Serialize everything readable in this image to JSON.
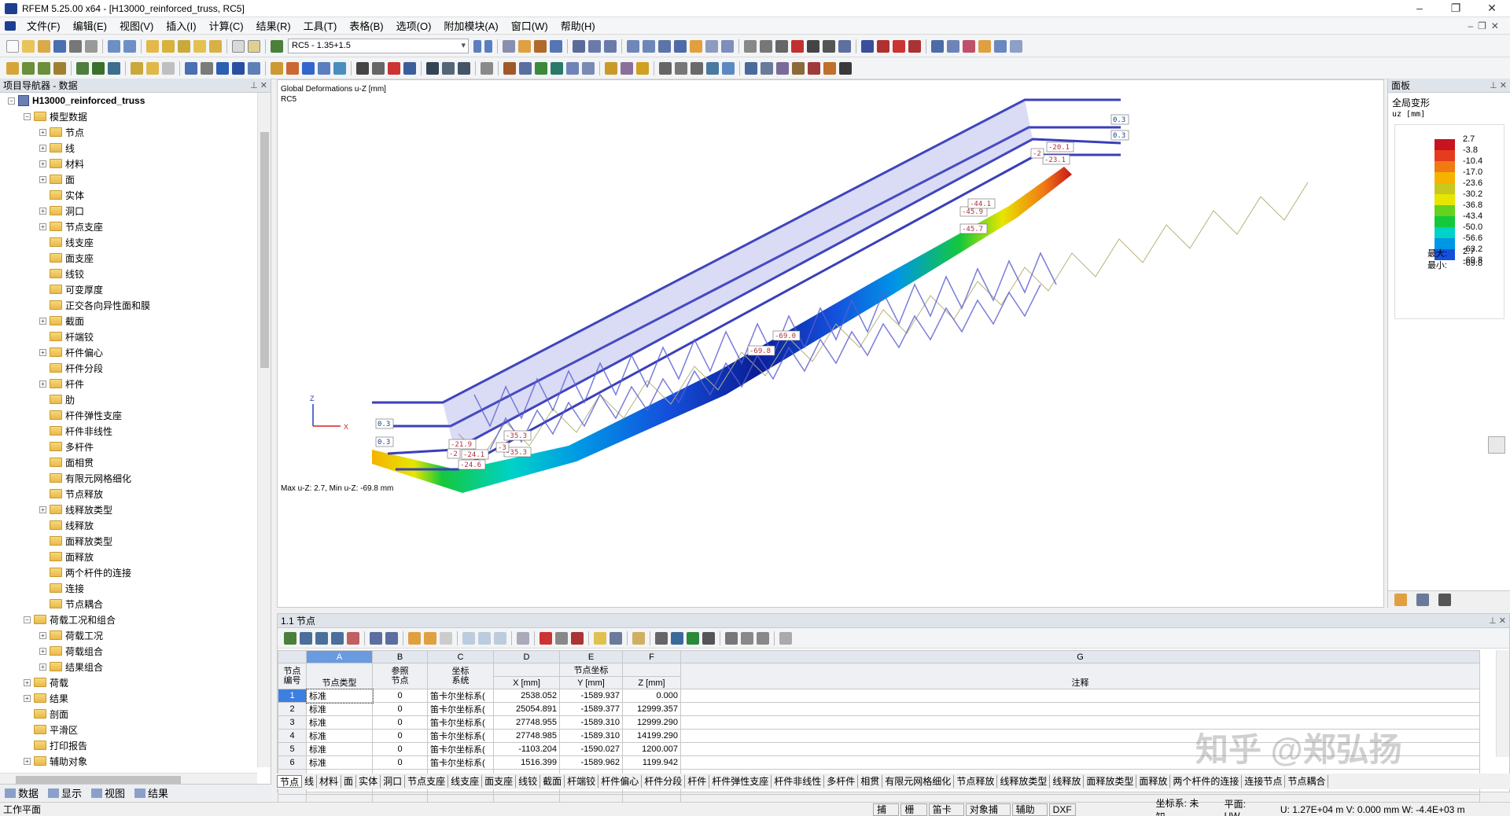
{
  "window": {
    "title": "RFEM 5.25.00 x64 - [H13000_reinforced_truss, RC5]"
  },
  "menu": [
    "文件(F)",
    "编辑(E)",
    "视图(V)",
    "插入(I)",
    "计算(C)",
    "结果(R)",
    "工具(T)",
    "表格(B)",
    "选项(O)",
    "附加模块(A)",
    "窗口(W)",
    "帮助(H)"
  ],
  "toolbar": {
    "loadcase": "RC5 - 1.35+1.5"
  },
  "navigator": {
    "title": "项目导航器 - 数据",
    "project": "H13000_reinforced_truss",
    "items": [
      "模型数据",
      "节点",
      "线",
      "材料",
      "面",
      "实体",
      "洞口",
      "节点支座",
      "线支座",
      "面支座",
      "线铰",
      "可变厚度",
      "正交各向异性面和膜",
      "截面",
      "杆端铰",
      "杆件偏心",
      "杆件分段",
      "杆件",
      "肋",
      "杆件弹性支座",
      "杆件非线性",
      "多杆件",
      "面相贯",
      "有限元网格细化",
      "节点释放",
      "线释放类型",
      "线释放",
      "面释放类型",
      "面释放",
      "两个杆件的连接",
      "连接",
      "节点耦合",
      "荷载工况和组合",
      "荷载工况",
      "荷载组合",
      "结果组合",
      "荷载",
      "结果",
      "剖面",
      "平滑区",
      "打印报告",
      "辅助对象"
    ],
    "tabs": [
      "数据",
      "显示",
      "视图",
      "结果"
    ]
  },
  "viewport": {
    "header1": "Global Deformations u-Z [mm]",
    "header2": "RC5",
    "footer": "Max u-Z: 2.7, Min u-Z: -69.8 mm",
    "axis_x": "X",
    "axis_z": "Z",
    "labels": [
      "0.3",
      "0.3",
      "-20.1",
      "-23.1",
      "-2",
      "-24.1",
      "-24.6",
      "-21.9",
      "-35.3",
      "-35.3",
      "-45.9",
      "-45.7",
      "-44.1",
      "-69.0",
      "-69.8",
      "0.3",
      "0.3",
      "-3",
      "-2"
    ]
  },
  "panel": {
    "title": "面板",
    "result": "全局变形",
    "unit": "uz [mm]",
    "legend_values": [
      "2.7",
      "-3.8",
      "-10.4",
      "-17.0",
      "-23.6",
      "-30.2",
      "-36.8",
      "-43.4",
      "-50.0",
      "-56.6",
      "-63.2",
      "-69.8"
    ],
    "legend_colors": [
      "#c8141e",
      "#e63c1e",
      "#f07a14",
      "#f5b200",
      "#c8c81e",
      "#e6e600",
      "#64d21e",
      "#14c83c",
      "#00d2c8",
      "#0096e6",
      "#1450dc",
      "#0a1e96"
    ],
    "max_label": "最大:",
    "max_val": "2.7",
    "min_label": "最小:",
    "min_val": "-69.8"
  },
  "table": {
    "title": "1.1 节点",
    "col_letters": [
      "A",
      "B",
      "C",
      "D",
      "E",
      "F",
      "G"
    ],
    "h_node": "节点\n编号",
    "h_type": "节点类型",
    "h_ref": "参照\n节点",
    "h_coord": "坐标\n系统",
    "h_coords_group": "节点坐标",
    "h_x": "X [mm]",
    "h_y": "Y [mm]",
    "h_z": "Z [mm]",
    "h_note": "注释",
    "rows": [
      {
        "no": "1",
        "type": "标准",
        "ref": "0",
        "cs": "笛卡尔坐标系(",
        "x": "2538.052",
        "y": "-1589.937",
        "z": "0.000"
      },
      {
        "no": "2",
        "type": "标准",
        "ref": "0",
        "cs": "笛卡尔坐标系(",
        "x": "25054.891",
        "y": "-1589.377",
        "z": "12999.357"
      },
      {
        "no": "3",
        "type": "标准",
        "ref": "0",
        "cs": "笛卡尔坐标系(",
        "x": "27748.955",
        "y": "-1589.310",
        "z": "12999.290"
      },
      {
        "no": "4",
        "type": "标准",
        "ref": "0",
        "cs": "笛卡尔坐标系(",
        "x": "27748.985",
        "y": "-1589.310",
        "z": "14199.290"
      },
      {
        "no": "5",
        "type": "标准",
        "ref": "0",
        "cs": "笛卡尔坐标系(",
        "x": "-1103.204",
        "y": "-1590.027",
        "z": "1200.007"
      },
      {
        "no": "6",
        "type": "标准",
        "ref": "0",
        "cs": "笛卡尔坐标系(",
        "x": "1516.399",
        "y": "-1589.962",
        "z": "1199.942"
      }
    ],
    "sheet_tabs": [
      "节点",
      "线",
      "材料",
      "面",
      "实体",
      "洞口",
      "节点支座",
      "线支座",
      "面支座",
      "线铰",
      "截面",
      "杆端铰",
      "杆件偏心",
      "杆件分段",
      "杆件",
      "杆件弹性支座",
      "杆件非线性",
      "多杆件",
      "相贯",
      "有限元网格细化",
      "节点释放",
      "线释放类型",
      "线释放",
      "面释放类型",
      "面释放",
      "两个杆件的连接",
      "连接节点",
      "节点耦合"
    ]
  },
  "status": {
    "left": "工作平面",
    "buttons": [
      "捕捉",
      "栅格",
      "笛卡尔",
      "对象捕捉",
      "辅助线",
      "DXF"
    ],
    "cs": "坐标系: 未知",
    "plane": "平面: UW",
    "coords": "U: 1.27E+04 m  V: 0.000 mm   W: -4.4E+03 m"
  },
  "watermark": "知乎 @郑弘扬"
}
